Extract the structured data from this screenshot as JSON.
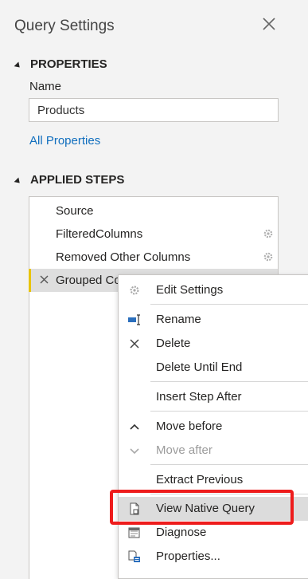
{
  "panel": {
    "title": "Query Settings",
    "close_icon": "close-icon"
  },
  "properties": {
    "header": "PROPERTIES",
    "name_label": "Name",
    "name_value": "Products",
    "all_properties_link": "All Properties"
  },
  "applied_steps": {
    "header": "APPLIED STEPS",
    "steps": [
      {
        "label": "Source",
        "has_settings": false
      },
      {
        "label": "FilteredColumns",
        "has_settings": true
      },
      {
        "label": "Removed Other Columns",
        "has_settings": true
      },
      {
        "label": "Grouped Columns",
        "has_settings": true,
        "selected": true
      }
    ]
  },
  "context_menu": {
    "items": [
      {
        "label": "Edit Settings",
        "icon": "gear-icon",
        "enabled": true
      },
      {
        "label": "Rename",
        "icon": "rename-icon",
        "enabled": true
      },
      {
        "label": "Delete",
        "icon": "delete-x-icon",
        "enabled": true
      },
      {
        "label": "Delete Until End",
        "icon": "",
        "enabled": true
      },
      {
        "label": "Insert Step After",
        "icon": "",
        "enabled": true
      },
      {
        "label": "Move before",
        "icon": "chevron-up-icon",
        "enabled": true
      },
      {
        "label": "Move after",
        "icon": "chevron-down-icon",
        "enabled": false
      },
      {
        "label": "Extract Previous",
        "icon": "",
        "enabled": true
      },
      {
        "label": "View Native Query",
        "icon": "document-icon",
        "enabled": true,
        "highlighted": true
      },
      {
        "label": "Diagnose",
        "icon": "diagnose-icon",
        "enabled": true
      },
      {
        "label": "Properties...",
        "icon": "properties-icon",
        "enabled": true
      }
    ]
  },
  "colors": {
    "link": "#106ebe",
    "selected_step_accent": "#e8c400",
    "highlight_box": "#ee1c1c"
  }
}
